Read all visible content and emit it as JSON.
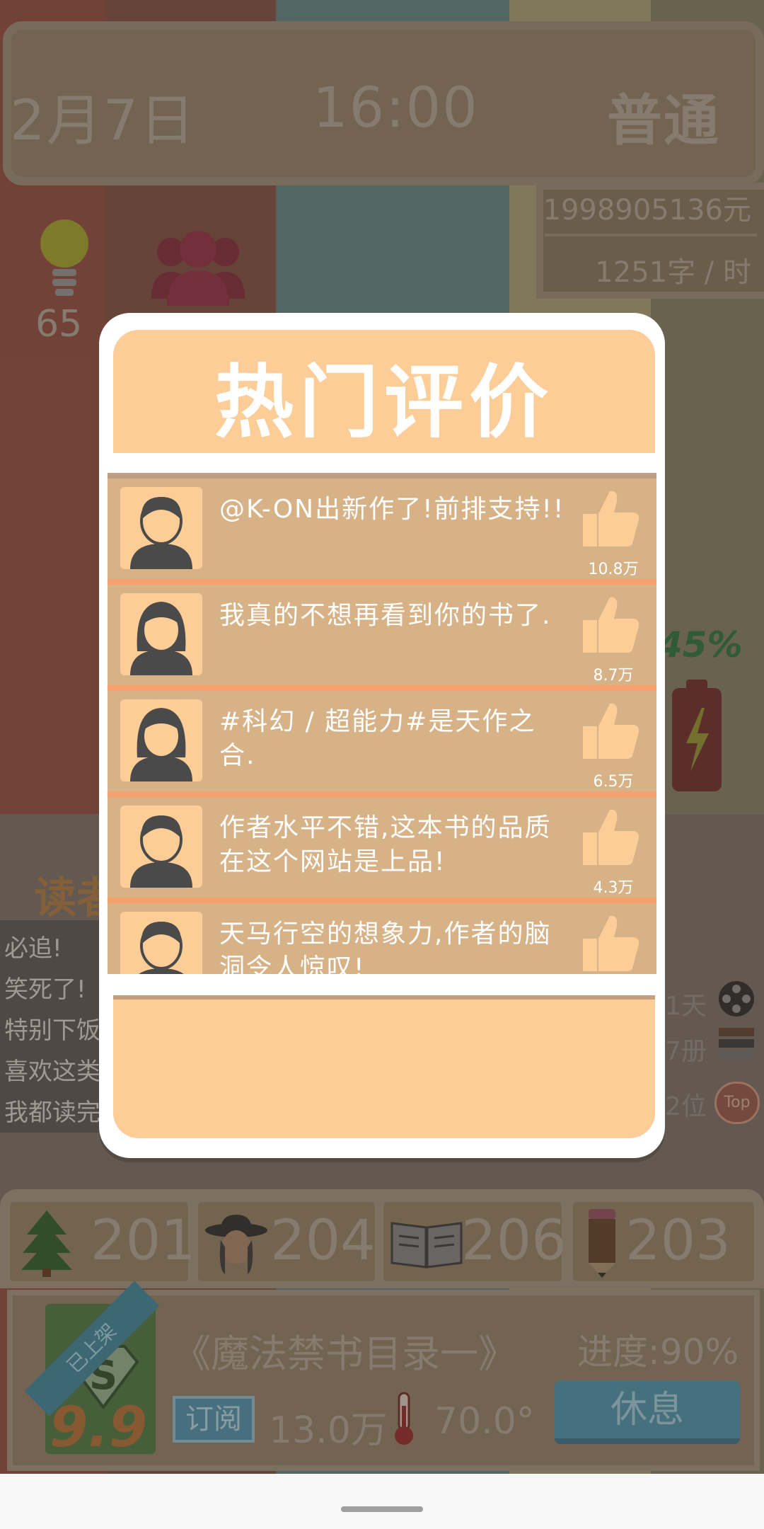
{
  "status": {
    "date": "2月7日",
    "time": "16:00",
    "difficulty": "普通",
    "money": "1998905136元",
    "speed": "1251字 / 时",
    "inspiration": "65"
  },
  "readers": {
    "title": "读者",
    "items": [
      "必追!",
      "笑死了!",
      "特别下饭",
      "喜欢这类",
      "我都读完"
    ]
  },
  "side": {
    "percent": "45%",
    "days": "1天",
    "books": "7册",
    "rank": "2位",
    "top_label": "Top"
  },
  "resources": {
    "tree": "201",
    "detective": "204",
    "book": "206",
    "pencil": "203"
  },
  "book": {
    "tag": "已上架",
    "score": "9.9",
    "title": "《魔法禁书目录一》",
    "progress": "进度:90%",
    "subscribe_label": "订阅",
    "subscribers": "13.0万",
    "temperature": "70.0°",
    "rest_label": "休息"
  },
  "dialog": {
    "title": "热门评价",
    "comments": [
      {
        "text": "@K-ON出新作了!前排支持!!",
        "likes": "10.8万",
        "avatar": "male"
      },
      {
        "text": "我真的不想再看到你的书了.",
        "likes": "8.7万",
        "avatar": "female"
      },
      {
        "text": "#科幻 / 超能力#是天作之合.",
        "likes": "6.5万",
        "avatar": "female"
      },
      {
        "text": "作者水平不错,这本书的品质在这个网站是上品!",
        "likes": "4.3万",
        "avatar": "male"
      },
      {
        "text": "天马行空的想象力,作者的脑洞令人惊叹!",
        "likes": "",
        "avatar": "male"
      }
    ]
  },
  "colors": {
    "dialog_header": "#fdcd98",
    "comment_bg": "#d7b287",
    "separator": "#f5a06e",
    "rest_button": "#4b8ca3"
  }
}
